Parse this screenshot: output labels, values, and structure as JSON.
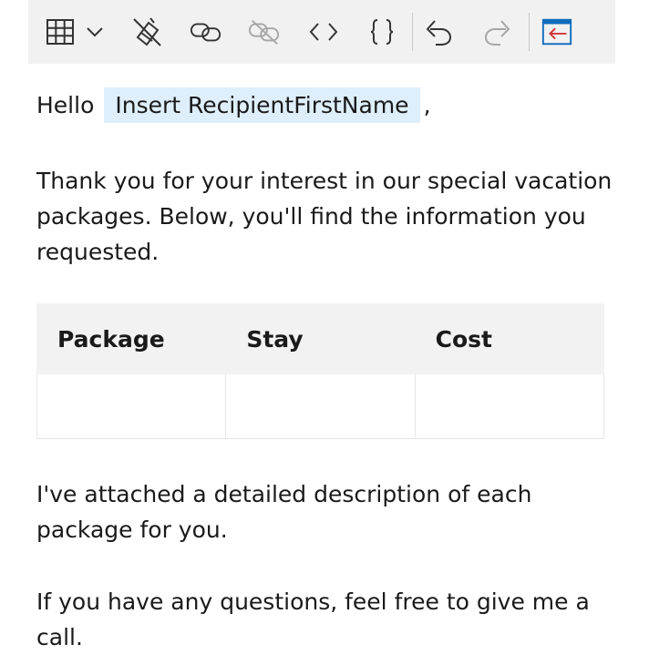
{
  "toolbar": {
    "items": [
      {
        "name": "table-icon"
      },
      {
        "name": "chevron-down-icon"
      },
      {
        "name": "clear-formatting-icon"
      },
      {
        "name": "link-icon"
      },
      {
        "name": "unlink-icon"
      },
      {
        "name": "code-view-icon"
      },
      {
        "name": "braces-icon"
      },
      {
        "name": "undo-icon"
      },
      {
        "name": "redo-icon"
      },
      {
        "name": "insert-field-icon"
      }
    ],
    "colors": {
      "background": "#f1f1f1",
      "icon": "#333333",
      "icon_disabled": "#a6a6a6",
      "accent_blue": "#0f6cbd",
      "accent_red": "#d13438"
    }
  },
  "email": {
    "greeting_word": "Hello",
    "recipient_token": "Insert RecipientFirstName",
    "greeting_comma": ",",
    "token_color": "#deeffb",
    "paragraph1": [
      "Thank you for your interest in our special vacation",
      "packages. Below, you'll find the information you",
      "requested."
    ],
    "table": {
      "headers": [
        "Package",
        "Stay",
        "Cost"
      ],
      "rows": [
        [
          "",
          "",
          ""
        ]
      ]
    },
    "paragraph2": [
      "I've attached a detailed description of each",
      "package for you."
    ],
    "paragraph3": [
      "If you have any questions, feel free to give me a",
      "call."
    ]
  }
}
